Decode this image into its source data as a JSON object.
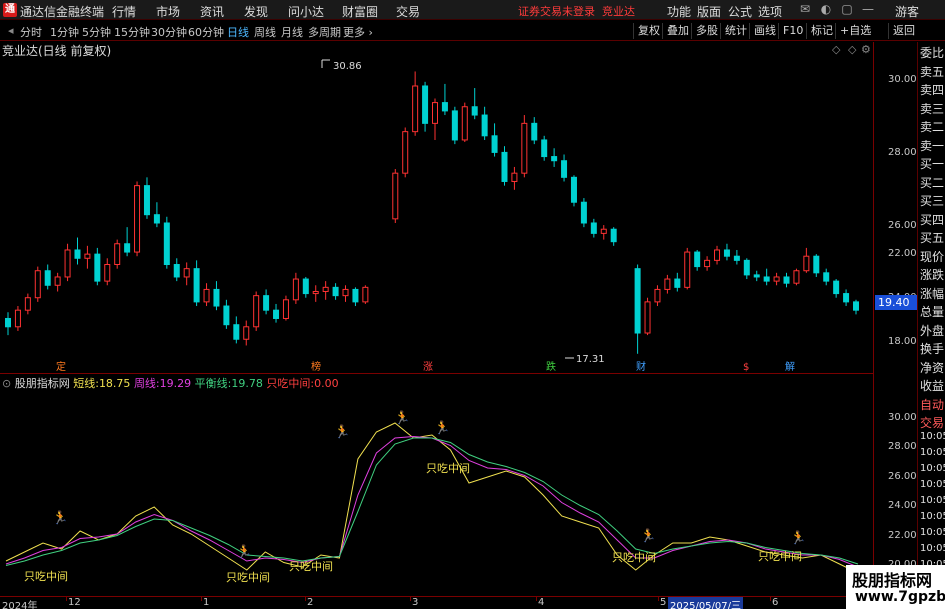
{
  "app": {
    "title": "通达信金融终端",
    "menus": [
      "行情",
      "市场",
      "资讯",
      "发现",
      "问小达",
      "财富圈",
      "交易"
    ],
    "notice": "证券交易未登录",
    "notice_stock": "竞业达",
    "right_menus": [
      "功能",
      "版面",
      "公式",
      "选项"
    ],
    "guest": "游客"
  },
  "periods": [
    "分时",
    "1分钟",
    "5分钟",
    "15分钟",
    "30分钟",
    "60分钟",
    "日线",
    "周线",
    "月线",
    "多周期",
    "更多"
  ],
  "active_period": "日线",
  "toolbar_right": [
    "复权",
    "叠加",
    "多股",
    "统计",
    "画线",
    "F10",
    "标记",
    "+自选",
    "返回"
  ],
  "main_chart": {
    "title": "竞业达(日线 前复权)",
    "high_label": "30.86",
    "low_label": "17.31",
    "current_price": "19.40",
    "y_ticks": [
      "30.00",
      "28.00",
      "26.00",
      "24.00",
      "22.00",
      "18.00"
    ],
    "event_markers": [
      "定",
      "榜",
      "涨",
      "跌",
      "财",
      "$",
      "解"
    ]
  },
  "side_panel": [
    "委比",
    "卖五",
    "卖四",
    "卖三",
    "卖二",
    "卖一",
    "买一",
    "买二",
    "买三",
    "买四",
    "买五",
    "现价",
    "涨跌",
    "涨幅",
    "总量",
    "外盘",
    "换手",
    "净资",
    "收益",
    "自动",
    "交易",
    "10:05",
    "10:05",
    "10:05",
    "10:05",
    "10:05",
    "10:05",
    "10:05",
    "10:05",
    "10:05",
    "10:05"
  ],
  "indicator": {
    "name": "股朋指标网",
    "short_label": "短线:",
    "short_value": "18.75",
    "week_label": "周线:",
    "week_value": "19.29",
    "balance_label": "平衡线:",
    "balance_value": "19.78",
    "zhichi_label": "只吃中间:",
    "zhichi_value": "0.00",
    "annotation": "只吃中间",
    "y_ticks": [
      "30.00",
      "28.00",
      "26.00",
      "24.00",
      "22.00",
      "20.00"
    ]
  },
  "date_axis": {
    "labels": [
      "2024年",
      "12",
      "1",
      "2",
      "3",
      "4",
      "5",
      "6"
    ],
    "selected": "2025/05/07/三"
  },
  "watermark": {
    "line1": "股朋指标网",
    "line2": "www.7gpzb.com"
  },
  "colors": {
    "up": "#ff3232",
    "down": "#00d2d2",
    "short": "#f0e050",
    "week": "#e040e0",
    "balance": "#40d080",
    "border": "#7a0000"
  },
  "chart_data": {
    "type": "candlestick",
    "y_range": [
      17.0,
      31.5
    ],
    "ohlc": [
      [
        19.0,
        19.3,
        18.2,
        18.6
      ],
      [
        18.6,
        19.6,
        18.4,
        19.4
      ],
      [
        19.4,
        20.2,
        19.2,
        20.0
      ],
      [
        20.0,
        21.5,
        19.8,
        21.3
      ],
      [
        21.3,
        21.6,
        20.4,
        20.6
      ],
      [
        20.6,
        21.2,
        20.3,
        21.0
      ],
      [
        21.0,
        22.6,
        20.8,
        22.3
      ],
      [
        22.3,
        22.9,
        21.6,
        21.9
      ],
      [
        21.9,
        22.5,
        21.4,
        22.1
      ],
      [
        22.1,
        22.4,
        20.6,
        20.8
      ],
      [
        20.8,
        21.9,
        20.6,
        21.6
      ],
      [
        21.6,
        22.8,
        21.4,
        22.6
      ],
      [
        22.6,
        23.4,
        22.0,
        22.2
      ],
      [
        22.2,
        25.6,
        22.0,
        25.4
      ],
      [
        25.4,
        25.8,
        23.8,
        24.0
      ],
      [
        24.0,
        24.6,
        23.4,
        23.6
      ],
      [
        23.6,
        23.9,
        21.4,
        21.6
      ],
      [
        21.6,
        21.9,
        20.8,
        21.0
      ],
      [
        21.0,
        21.7,
        20.6,
        21.4
      ],
      [
        21.4,
        21.8,
        19.6,
        19.8
      ],
      [
        19.8,
        20.7,
        19.6,
        20.4
      ],
      [
        20.4,
        20.8,
        19.4,
        19.6
      ],
      [
        19.6,
        19.9,
        18.5,
        18.7
      ],
      [
        18.7,
        19.1,
        17.8,
        18.0
      ],
      [
        18.0,
        18.9,
        17.7,
        18.6
      ],
      [
        18.6,
        20.3,
        18.4,
        20.1
      ],
      [
        20.1,
        20.4,
        19.2,
        19.4
      ],
      [
        19.4,
        19.7,
        18.8,
        19.0
      ],
      [
        19.0,
        20.1,
        18.9,
        19.9
      ],
      [
        19.9,
        21.2,
        19.7,
        20.9
      ],
      [
        20.9,
        21.0,
        20.0,
        20.2
      ],
      [
        20.2,
        20.6,
        19.8,
        20.3
      ],
      [
        20.3,
        20.8,
        19.9,
        20.5
      ],
      [
        20.5,
        20.7,
        19.9,
        20.1
      ],
      [
        20.1,
        20.6,
        19.8,
        20.4
      ],
      [
        20.4,
        20.5,
        19.6,
        19.8
      ],
      [
        19.8,
        20.6,
        19.7,
        20.5
      ],
      [
        23.8,
        26.2,
        23.6,
        26.0
      ],
      [
        26.0,
        28.2,
        25.8,
        28.0
      ],
      [
        28.0,
        30.9,
        27.8,
        30.2
      ],
      [
        30.2,
        30.4,
        28.0,
        28.4
      ],
      [
        28.4,
        29.6,
        27.6,
        29.4
      ],
      [
        29.4,
        30.3,
        28.8,
        29.0
      ],
      [
        29.0,
        29.2,
        27.4,
        27.6
      ],
      [
        27.6,
        29.4,
        27.5,
        29.2
      ],
      [
        29.2,
        30.1,
        28.6,
        28.8
      ],
      [
        28.8,
        29.2,
        27.6,
        27.8
      ],
      [
        27.8,
        28.4,
        26.8,
        27.0
      ],
      [
        27.0,
        27.3,
        25.4,
        25.6
      ],
      [
        25.6,
        26.3,
        25.2,
        26.0
      ],
      [
        26.0,
        28.8,
        25.8,
        28.4
      ],
      [
        28.4,
        28.7,
        27.4,
        27.6
      ],
      [
        27.6,
        27.8,
        26.6,
        26.8
      ],
      [
        26.8,
        27.2,
        26.3,
        26.6
      ],
      [
        26.6,
        26.9,
        25.6,
        25.8
      ],
      [
        25.8,
        25.9,
        24.4,
        24.6
      ],
      [
        24.6,
        24.8,
        23.4,
        23.6
      ],
      [
        23.6,
        23.8,
        22.9,
        23.1
      ],
      [
        23.1,
        23.5,
        22.8,
        23.3
      ],
      [
        23.3,
        23.4,
        22.5,
        22.7
      ],
      [
        21.4,
        21.6,
        17.3,
        18.3
      ],
      [
        18.3,
        20.0,
        18.2,
        19.8
      ],
      [
        19.8,
        20.6,
        19.6,
        20.4
      ],
      [
        20.4,
        21.1,
        20.2,
        20.9
      ],
      [
        20.9,
        21.2,
        20.3,
        20.5
      ],
      [
        20.5,
        22.4,
        20.4,
        22.2
      ],
      [
        22.2,
        22.3,
        21.3,
        21.5
      ],
      [
        21.5,
        22.0,
        21.3,
        21.8
      ],
      [
        21.8,
        22.5,
        21.6,
        22.3
      ],
      [
        22.3,
        22.6,
        21.8,
        22.0
      ],
      [
        22.0,
        22.3,
        21.6,
        21.8
      ],
      [
        21.8,
        21.9,
        20.9,
        21.1
      ],
      [
        21.1,
        21.3,
        20.8,
        21.0
      ],
      [
        21.0,
        21.4,
        20.6,
        20.8
      ],
      [
        20.8,
        21.2,
        20.6,
        21.0
      ],
      [
        21.0,
        21.2,
        20.5,
        20.7
      ],
      [
        20.7,
        21.4,
        20.6,
        21.3
      ],
      [
        21.3,
        22.4,
        21.2,
        22.0
      ],
      [
        22.0,
        22.1,
        21.0,
        21.2
      ],
      [
        21.2,
        21.4,
        20.6,
        20.8
      ],
      [
        20.8,
        20.9,
        20.0,
        20.2
      ],
      [
        20.2,
        20.4,
        19.6,
        19.8
      ],
      [
        19.8,
        19.9,
        19.2,
        19.4
      ]
    ],
    "indicator_series": [
      {
        "name": "短线",
        "values": [
          20.2,
          20.8,
          21.4,
          21.0,
          22.2,
          21.6,
          22.0,
          23.2,
          23.8,
          22.6,
          22.0,
          21.2,
          20.4,
          19.6,
          20.8,
          20.1,
          19.8,
          20.6,
          20.4,
          27.0,
          28.8,
          29.4,
          28.4,
          28.6,
          27.6,
          25.4,
          25.8,
          26.2,
          25.8,
          24.6,
          23.2,
          22.8,
          22.4,
          20.6,
          19.6,
          20.6,
          21.4,
          21.4,
          21.8,
          21.6,
          21.2,
          20.8,
          20.6,
          20.4,
          20.6,
          20.0,
          19.4
        ]
      },
      {
        "name": "周线",
        "values": [
          20.0,
          20.4,
          20.9,
          21.1,
          21.7,
          21.8,
          22.0,
          22.8,
          23.3,
          22.9,
          22.2,
          21.6,
          20.9,
          20.2,
          20.4,
          20.3,
          20.1,
          20.4,
          20.5,
          24.6,
          27.4,
          28.4,
          28.5,
          28.4,
          27.9,
          26.9,
          26.4,
          26.3,
          25.9,
          25.2,
          24.1,
          23.4,
          22.8,
          21.6,
          20.4,
          20.4,
          20.9,
          21.2,
          21.5,
          21.6,
          21.4,
          21.0,
          20.8,
          20.6,
          20.6,
          20.3,
          19.8
        ]
      },
      {
        "name": "平衡线",
        "values": [
          19.9,
          20.2,
          20.6,
          20.9,
          21.4,
          21.6,
          21.9,
          22.5,
          23.0,
          22.9,
          22.4,
          21.9,
          21.3,
          20.6,
          20.5,
          20.4,
          20.2,
          20.4,
          20.5,
          23.5,
          26.6,
          28.0,
          28.4,
          28.4,
          28.1,
          27.3,
          26.8,
          26.5,
          26.1,
          25.5,
          24.6,
          23.9,
          23.3,
          22.2,
          21.0,
          20.7,
          21.0,
          21.2,
          21.4,
          21.5,
          21.4,
          21.1,
          20.9,
          20.7,
          20.6,
          20.4,
          20.0
        ]
      }
    ]
  }
}
